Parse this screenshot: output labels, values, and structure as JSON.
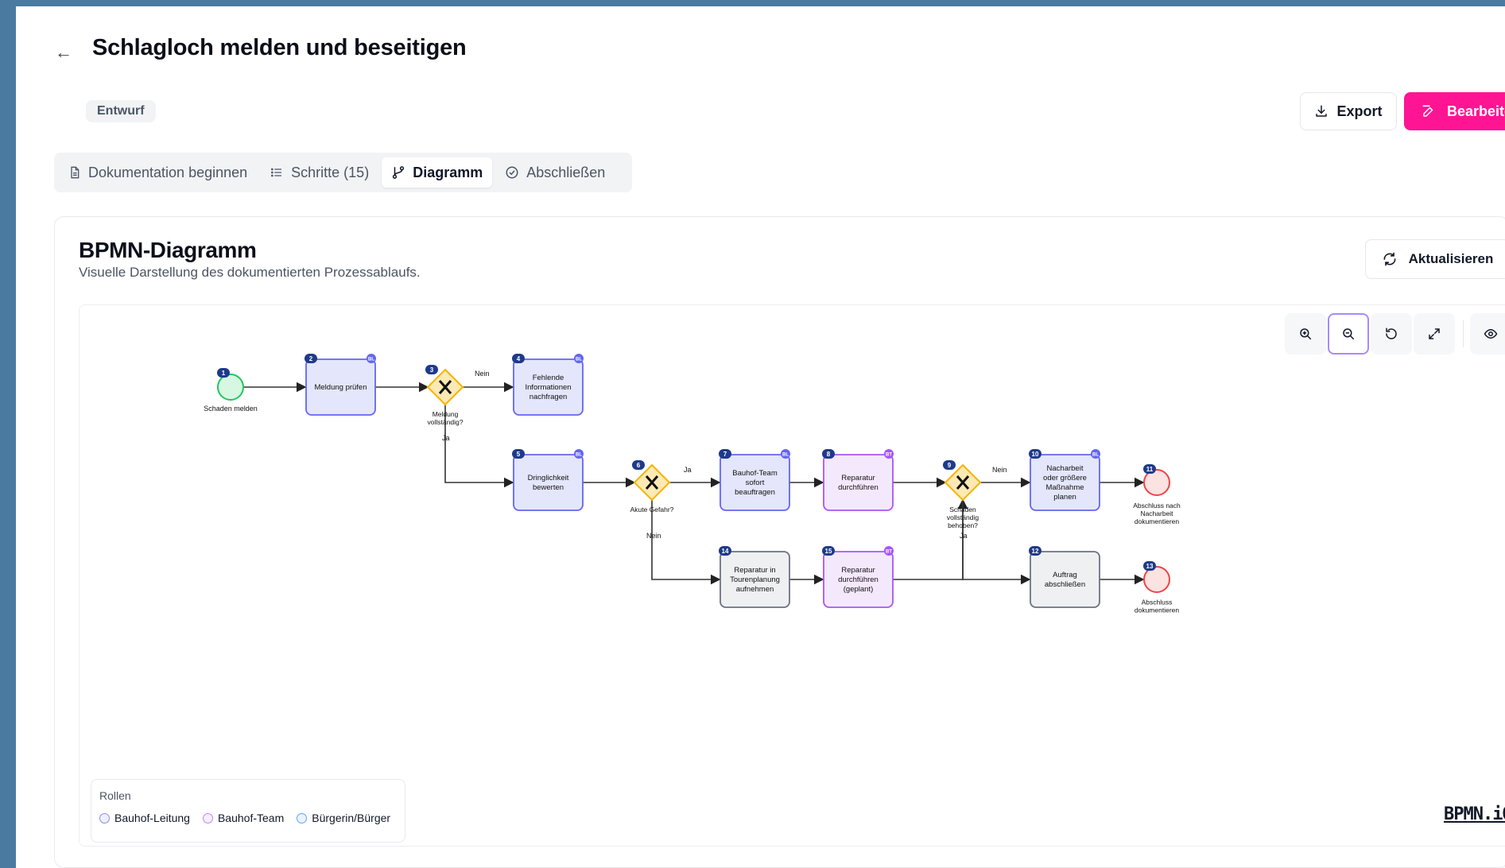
{
  "header": {
    "back_icon": "arrow-left-icon",
    "title": "Schlagloch melden und beseitigen",
    "status_badge": "Entwurf",
    "export_label": "Export",
    "edit_label": "Bearbeiten"
  },
  "tabs": [
    {
      "label": "Dokumentation beginnen",
      "icon": "document-icon",
      "active": false
    },
    {
      "label": "Schritte (15)",
      "icon": "list-icon",
      "active": false
    },
    {
      "label": "Diagramm",
      "icon": "branch-icon",
      "active": true
    },
    {
      "label": "Abschließen",
      "icon": "check-circle-icon",
      "active": false
    }
  ],
  "card": {
    "title": "BPMN-Diagramm",
    "subtitle": "Visuelle Darstellung des dokumentierten Prozessablaufs.",
    "refresh_label": "Aktualisieren"
  },
  "toolbar": {
    "buttons": [
      "zoom-in-icon",
      "zoom-out-icon",
      "reset-icon",
      "fullscreen-icon",
      "eye-icon"
    ],
    "active": "zoom-out-icon"
  },
  "diagram": {
    "start": {
      "num": "1",
      "label": "Schaden melden"
    },
    "tasks": [
      {
        "num": "2",
        "role": "BL",
        "label": [
          "Meldung prüfen"
        ]
      },
      {
        "num": "4",
        "role": "BL",
        "label": [
          "Fehlende",
          "Informationen",
          "nachfragen"
        ]
      },
      {
        "num": "5",
        "role": "BL",
        "label": [
          "Dringlichkeit",
          "bewerten"
        ]
      },
      {
        "num": "7",
        "role": "BL",
        "label": [
          "Bauhof-Team",
          "sofort",
          "beauftragen"
        ]
      },
      {
        "num": "8",
        "role": "BT",
        "label": [
          "Reparatur",
          "durchführen"
        ]
      },
      {
        "num": "10",
        "role": "BL",
        "label": [
          "Nacharbeit",
          "oder größere",
          "Maßnahme",
          "planen"
        ]
      },
      {
        "num": "12",
        "role": "",
        "label": [
          "Auftrag",
          "abschließen"
        ]
      },
      {
        "num": "14",
        "role": "",
        "label": [
          "Reparatur in",
          "Tourenplanung",
          "aufnehmen"
        ]
      },
      {
        "num": "15",
        "role": "BT",
        "label": [
          "Reparatur",
          "durchführen",
          "(geplant)"
        ]
      }
    ],
    "gateways": [
      {
        "num": "3",
        "label": [
          "Meldung",
          "vollständig?"
        ]
      },
      {
        "num": "6",
        "label": [
          "Akute Gefahr?"
        ]
      },
      {
        "num": "9",
        "label": [
          "Schaden",
          "vollständig",
          "behoben?"
        ]
      }
    ],
    "ends": [
      {
        "num": "11",
        "label": [
          "Abschluss nach",
          "Nacharbeit",
          "dokumentieren"
        ]
      },
      {
        "num": "13",
        "label": [
          "Abschluss",
          "dokumentieren"
        ]
      }
    ],
    "flow_labels": {
      "no": "Nein",
      "yes": "Ja"
    }
  },
  "legend": {
    "title": "Rollen",
    "items": [
      {
        "label": "Bauhof-Leitung",
        "color": "#8b8ff0"
      },
      {
        "label": "Bauhof-Team",
        "color": "#c084fc"
      },
      {
        "label": "Bürgerin/Bürger",
        "color": "#60a5fa"
      }
    ]
  },
  "brand": "BPMN.iO",
  "colors": {
    "accent": "#ff1493",
    "task_bl_fill": "#e4e6fb",
    "task_bl_stroke": "#6366f1",
    "task_bt_fill": "#f4e8fd",
    "task_bt_stroke": "#a855f7",
    "gateway_fill": "#fde9b3",
    "gateway_stroke": "#f5b400",
    "badge": "#1e3a8a"
  }
}
